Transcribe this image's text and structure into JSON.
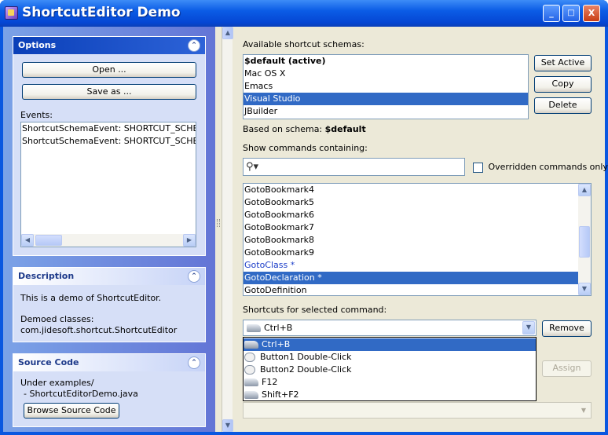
{
  "window": {
    "title": "ShortcutEditor Demo",
    "minimize_glyph": "_",
    "maximize_glyph": "□",
    "close_glyph": "X"
  },
  "options": {
    "title": "Options",
    "open_label": "Open ...",
    "save_label": "Save as ...",
    "events_label": "Events:",
    "events": [
      "ShortcutSchemaEvent: SHORTCUT_SCHEMA_I",
      "ShortcutSchemaEvent: SHORTCUT_SCHEMA_I"
    ]
  },
  "description": {
    "title": "Description",
    "text": "This is a demo of ShortcutEditor.",
    "demoed_label": "Demoed classes:",
    "demoed_class": "com.jidesoft.shortcut.ShortcutEditor"
  },
  "source": {
    "title": "Source Code",
    "under": "Under examples/",
    "file": "- ShortcutEditorDemo.java",
    "browse_label": "Browse Source Code"
  },
  "schemas": {
    "label": "Available shortcut schemas:",
    "items": [
      "$default (active)",
      "Mac OS X",
      "Emacs",
      "Visual Studio",
      "JBuilder"
    ],
    "selected_index": 3,
    "set_active_label": "Set Active",
    "copy_label": "Copy",
    "delete_label": "Delete",
    "based_on_label": "Based on schema:",
    "based_on_value": "$default"
  },
  "commands": {
    "label": "Show commands containing:",
    "search_value": "",
    "overridden_label": "Overridden commands only",
    "overridden_checked": false,
    "items": [
      "GotoBookmark4",
      "GotoBookmark5",
      "GotoBookmark6",
      "GotoBookmark7",
      "GotoBookmark8",
      "GotoBookmark9",
      "GotoClass *",
      "GotoDeclaration *",
      "GotoDefinition"
    ],
    "selected_index": 7,
    "override_color": "#1a3cc8"
  },
  "shortcuts": {
    "label": "Shortcuts for selected command:",
    "combo_value": "Ctrl+B",
    "remove_label": "Remove",
    "assign_label": "Assign",
    "dropdown_items": [
      {
        "label": "Ctrl+B",
        "icon": "keyboard-icon"
      },
      {
        "label": "Button1 Double-Click",
        "icon": "mouse-icon"
      },
      {
        "label": "Button2 Double-Click",
        "icon": "mouse-icon"
      },
      {
        "label": "F12",
        "icon": "keyboard-icon"
      },
      {
        "label": "Shift+F2",
        "icon": "keyboard-icon"
      }
    ],
    "selected_index": 0
  },
  "colors": {
    "accent": "#316ac5",
    "title_bar": "#0a57e0",
    "panel_header": "#1e3a8a"
  }
}
